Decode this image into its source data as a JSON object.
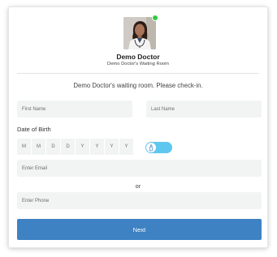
{
  "doctor": {
    "name": "Demo Doctor",
    "room_label": "Demo Doctor's Waiting Room",
    "status": "online",
    "status_color": "#2ecc40"
  },
  "checkin_message": "Demo Doctor's waiting room. Please check-in.",
  "form": {
    "first_name": {
      "placeholder": "First Name",
      "value": ""
    },
    "last_name": {
      "placeholder": "Last Name",
      "value": ""
    },
    "dob": {
      "label": "Date of Birth",
      "placeholders": [
        "M",
        "M",
        "D",
        "D",
        "Y",
        "Y",
        "Y",
        "Y"
      ]
    },
    "accessibility_toggle": {
      "icon": "hand-icon",
      "on": true,
      "color": "#5ec7ef"
    },
    "email": {
      "placeholder": "Enter Email",
      "value": ""
    },
    "separator": "or",
    "phone": {
      "placeholder": "Enter Phone",
      "value": ""
    },
    "submit_label": "Next",
    "submit_color": "#3e82c4"
  }
}
